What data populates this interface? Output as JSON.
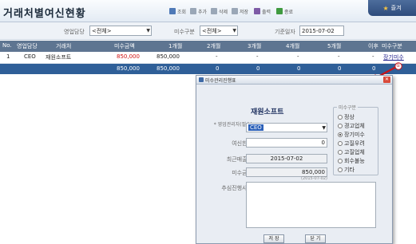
{
  "app": {
    "title": "거래처별여신현황"
  },
  "toolbar": [
    {
      "label": "조회",
      "icon": "search-icon",
      "color": "#4e79b7"
    },
    {
      "label": "추가",
      "icon": "add-icon",
      "color": "#9aa7b7"
    },
    {
      "label": "삭제",
      "icon": "delete-icon",
      "color": "#9aa7b7"
    },
    {
      "label": "저장",
      "icon": "save-icon",
      "color": "#9aa7b7"
    },
    {
      "label": "출력",
      "icon": "print-icon",
      "color": "#7d5aa6"
    },
    {
      "label": "종료",
      "icon": "exit-icon",
      "color": "#3f9a3f"
    }
  ],
  "bookmark": {
    "label": "즐겨"
  },
  "filters": {
    "sales_owner_label": "영업담당",
    "sales_owner_value": "<전체>",
    "receivable_type_label": "미수구분",
    "receivable_type_value": "<전체>",
    "base_date_label": "기준일자",
    "base_date_value": "2015-07-02"
  },
  "table": {
    "columns": [
      "No.",
      "영업담당",
      "거래처",
      "미수금액",
      "1개월",
      "2개월",
      "3개월",
      "4개월",
      "5개월",
      "이후",
      "미수구분"
    ],
    "rows": [
      [
        "1",
        "CEO",
        "재원소프트",
        "850,000",
        "850,000",
        "-",
        "-",
        "-",
        "-",
        "-",
        "장기미수"
      ]
    ],
    "total": [
      "",
      "",
      "",
      "850,000",
      "850,000",
      "0",
      "0",
      "0",
      "0",
      "0",
      ""
    ]
  },
  "dialog": {
    "title": "미수관리진행표",
    "company": "재원소프트",
    "owner_label": "* 영업관리자(필수)",
    "owner_value": "CEO",
    "credit_label": "여신한도",
    "credit_value": "0",
    "last_sale_label": "최근매출일",
    "last_sale_value": "2015-07-02",
    "receivable_label": "미수금액",
    "receivable_value": "850,000",
    "receivable_note": "(2015-07-02)",
    "followup_label": "추심진행사항",
    "group_label": "미수구분",
    "options": [
      "정상",
      "경고업체",
      "장기미수",
      "고질우려",
      "고질업체",
      "회수불능",
      "기타"
    ],
    "selected_option": "장기미수",
    "save_label": "저 장",
    "close_label": "닫 기",
    "annotation": "①"
  }
}
